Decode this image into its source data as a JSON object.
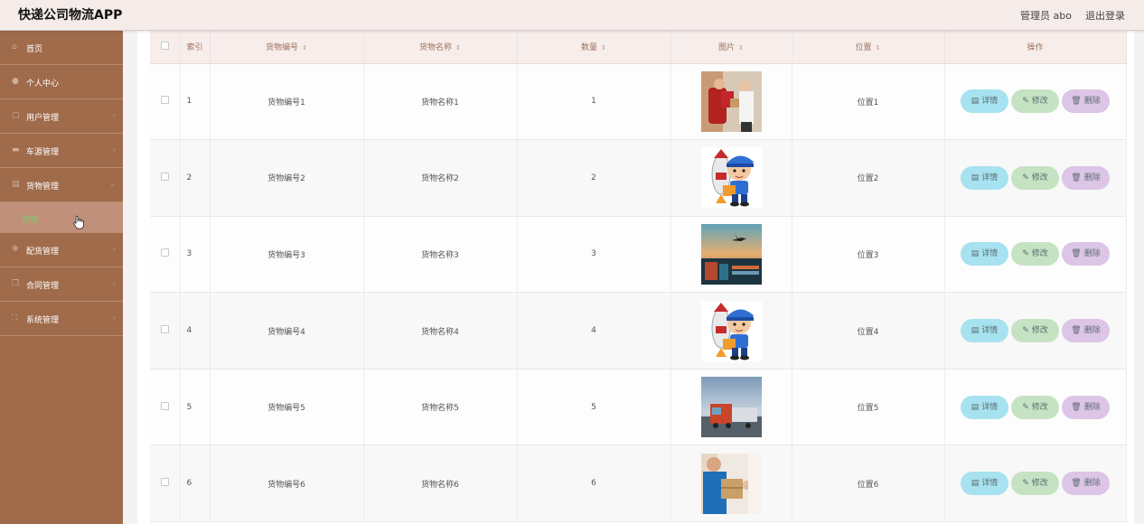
{
  "header": {
    "app_title": "快递公司物流APP",
    "admin_label": "管理员 abo",
    "logout_label": "退出登录"
  },
  "sidebar": {
    "items": [
      {
        "label": "首页",
        "icon": "home-icon"
      },
      {
        "label": "个人中心",
        "icon": "user-icon"
      },
      {
        "label": "用户管理",
        "icon": "users-icon"
      },
      {
        "label": "车源管理",
        "icon": "truck-icon"
      },
      {
        "label": "货物管理",
        "icon": "box-icon"
      },
      {
        "label": "配货管理",
        "icon": "gear-icon"
      },
      {
        "label": "合同管理",
        "icon": "document-icon"
      },
      {
        "label": "系统管理",
        "icon": "settings-icon"
      }
    ],
    "active_sub": "货物"
  },
  "table": {
    "columns": [
      "索引",
      "货物编号",
      "货物名称",
      "数量",
      "图片",
      "位置",
      "操作"
    ],
    "rows": [
      {
        "index": "1",
        "code": "货物编号1",
        "name": "货物名称1",
        "qty": "1",
        "image": "delivery-photo",
        "location": "位置1"
      },
      {
        "index": "2",
        "code": "货物编号2",
        "name": "货物名称2",
        "qty": "2",
        "image": "courier-cartoon",
        "location": "位置2"
      },
      {
        "index": "3",
        "code": "货物编号3",
        "name": "货物名称3",
        "qty": "3",
        "image": "port-plane-photo",
        "location": "位置3"
      },
      {
        "index": "4",
        "code": "货物编号4",
        "name": "货物名称4",
        "qty": "4",
        "image": "courier-cartoon",
        "location": "位置4"
      },
      {
        "index": "5",
        "code": "货物编号5",
        "name": "货物名称5",
        "qty": "5",
        "image": "truck-road-photo",
        "location": "位置5"
      },
      {
        "index": "6",
        "code": "货物编号6",
        "name": "货物名称6",
        "qty": "6",
        "image": "package-handover-photo",
        "location": "位置6"
      }
    ],
    "actions": {
      "detail": "详情",
      "edit": "修改",
      "delete": "删除"
    }
  },
  "colors": {
    "sidebar_bg": "#a06b4b",
    "header_bg": "#f5ecea",
    "active_sub_text": "#7ec96e",
    "detail_btn": "#a6e2ef",
    "edit_btn": "#c5e3c2",
    "delete_btn": "#dcc5e6"
  }
}
